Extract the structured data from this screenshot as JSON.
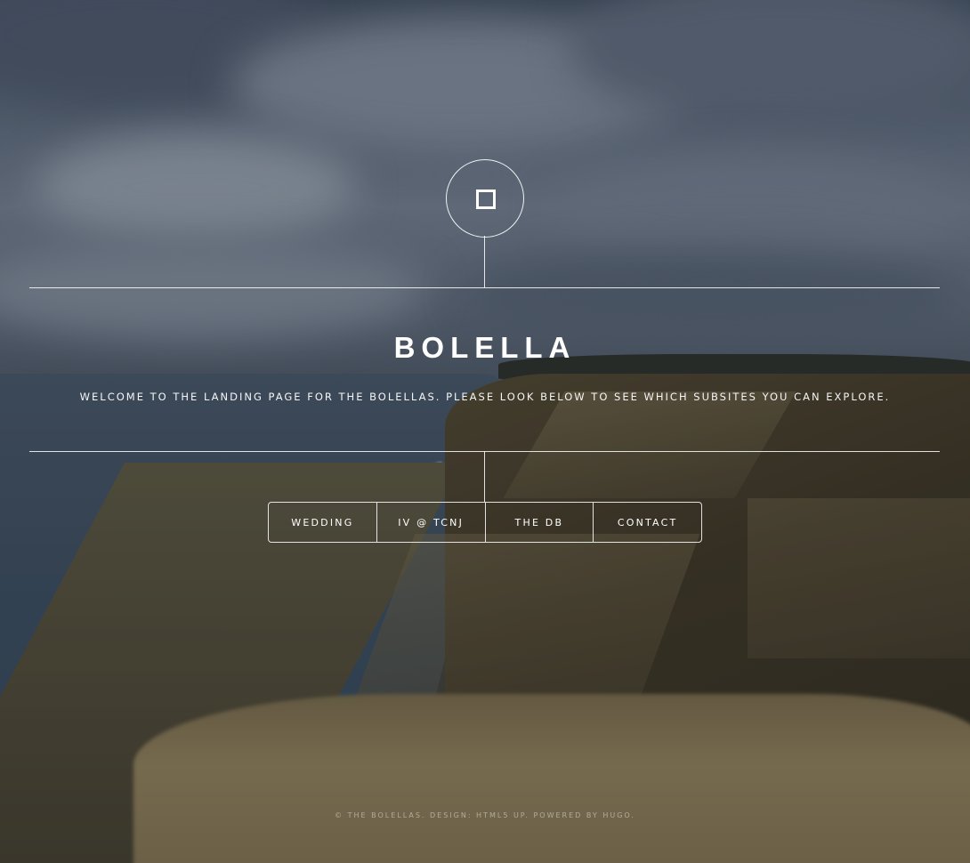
{
  "logo": {
    "icon": "square-outline-icon"
  },
  "header": {
    "title": "BOLELLA",
    "intro": "WELCOME TO THE LANDING PAGE FOR THE BOLELLAS. PLEASE LOOK BELOW TO SEE WHICH SUBSITES YOU CAN EXPLORE."
  },
  "nav": {
    "items": [
      {
        "label": "WEDDING"
      },
      {
        "label": "IV @ TCNJ"
      },
      {
        "label": "THE DB"
      },
      {
        "label": "CONTACT"
      }
    ]
  },
  "footer": {
    "text": "© THE BOLELLAS. DESIGN: HTML5 UP. POWERED BY HUGO."
  },
  "colors": {
    "text": "#ffffff",
    "lines": "#ffffff"
  }
}
